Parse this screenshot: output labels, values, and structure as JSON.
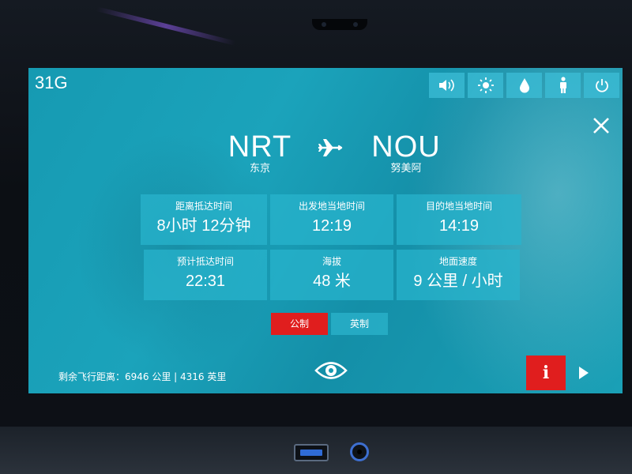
{
  "seat": "31G",
  "route": {
    "origin_code": "NRT",
    "origin_city": "东京",
    "dest_code": "NOU",
    "dest_city": "努美阿"
  },
  "stats": [
    {
      "label": "距离抵达时间",
      "value": "8小时 12分钟"
    },
    {
      "label": "出发地当地时间",
      "value": "12:19"
    },
    {
      "label": "目的地当地时间",
      "value": "14:19"
    },
    {
      "label": "预计抵达时间",
      "value": "22:31"
    },
    {
      "label": "海拔",
      "value": "48 米"
    },
    {
      "label": "地面速度",
      "value": "9 公里 / 小时"
    }
  ],
  "units": {
    "metric": "公制",
    "imperial": "英制",
    "selected": "metric"
  },
  "remaining_distance": "剩余飞行距离：6946 公里 | 4316 英里",
  "info_label": "i",
  "icons": {
    "volume": "speaker-icon",
    "brightness": "sun-icon",
    "contrast": "drop-icon",
    "attendant": "person-icon",
    "power": "power-icon",
    "close": "close-icon",
    "plane": "airplane-icon",
    "view": "eye-icon",
    "next": "play-icon"
  },
  "colors": {
    "screen": "#169ab2",
    "tile": "#28b4cd",
    "active": "#e01e1e"
  }
}
